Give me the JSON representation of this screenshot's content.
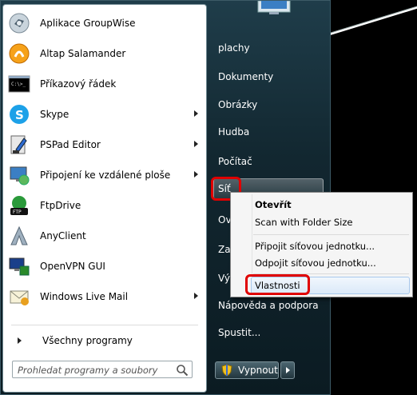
{
  "programs": [
    {
      "label": "Aplikace GroupWise",
      "icon": "groupwise-icon",
      "submenu": false
    },
    {
      "label": "Altap Salamander",
      "icon": "salamander-icon",
      "submenu": false
    },
    {
      "label": "Příkazový řádek",
      "icon": "command-prompt-icon",
      "submenu": false
    },
    {
      "label": "Skype",
      "icon": "skype-icon",
      "submenu": true
    },
    {
      "label": "PSPad Editor",
      "icon": "pspad-icon",
      "submenu": true
    },
    {
      "label": "Připojení ke vzdálené ploše",
      "icon": "remote-desktop-icon",
      "submenu": true
    },
    {
      "label": "FtpDrive",
      "icon": "ftpdrive-icon",
      "submenu": false
    },
    {
      "label": "AnyClient",
      "icon": "anyclient-icon",
      "submenu": false
    },
    {
      "label": "OpenVPN GUI",
      "icon": "openvpn-icon",
      "submenu": false
    },
    {
      "label": "Windows Live Mail",
      "icon": "windows-live-mail-icon",
      "submenu": true
    }
  ],
  "all_programs": "Všechny programy",
  "search": {
    "placeholder": "Prohledat programy a soubory"
  },
  "right": {
    "plachy": "plachy",
    "dokumenty": "Dokumenty",
    "obrazky": "Obrázky",
    "hudba": "Hudba",
    "pocitac": "Počítač",
    "sit": "Síť",
    "ov": "Ov",
    "za": "Za",
    "vy": "Vý",
    "napoveda": "Nápověda a podpora",
    "spustit": "Spustit..."
  },
  "shutdown": "Vypnout",
  "context_menu": {
    "otevrit": "Otevřít",
    "scan": "Scan with Folder Size",
    "pripojit": "Připojit síťovou jednotku...",
    "odpojit": "Odpojit síťovou jednotku...",
    "vlastnosti": "Vlastnosti"
  },
  "colors": {
    "highlight_red": "#e00000",
    "menu_bg": "#1f3d4a"
  }
}
